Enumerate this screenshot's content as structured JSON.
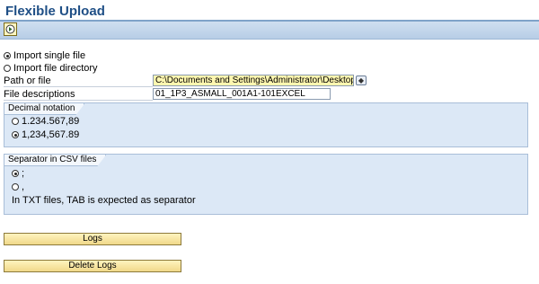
{
  "header": {
    "title": "Flexible Upload"
  },
  "toolbar": {
    "execute_icon": "execute-icon"
  },
  "import": {
    "single_file_label": "Import single file",
    "directory_label": "Import file directory",
    "selected": "single"
  },
  "path": {
    "label": "Path or file",
    "value": "C:\\Documents and Settings\\Administrator\\Desktop\\SKF Tr"
  },
  "descriptions": {
    "label": "File descriptions",
    "value": "01_1P3_ASMALL_001A1-101EXCEL"
  },
  "decimal": {
    "title": "Decimal notation",
    "option1": "1.234.567,89",
    "option2": "1,234,567.89",
    "selected": "option2"
  },
  "separator": {
    "title": "Separator in CSV files",
    "option1": ";",
    "option2": ",",
    "selected": "option1",
    "note": "In TXT files, TAB is expected as separator"
  },
  "buttons": {
    "logs_label": "Logs",
    "delete_logs_label": "Delete Logs"
  }
}
